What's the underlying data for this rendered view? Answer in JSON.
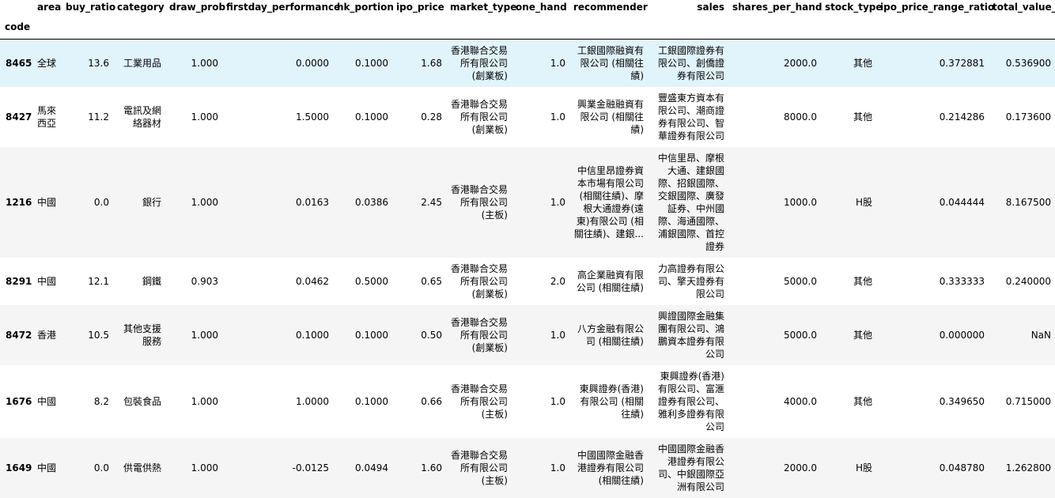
{
  "columns": [
    "area",
    "buy_ratio",
    "category",
    "draw_prob",
    "firstday_performance",
    "hk_portion",
    "ipo_price",
    "market_type",
    "one_hand",
    "recommender",
    "sales",
    "shares_per_hand",
    "stock_type",
    "ipo_price_range_ratio",
    "total_value_mid"
  ],
  "index_name": "code",
  "rows": [
    {
      "code": "8465",
      "area": "全球",
      "buy_ratio": "13.6",
      "category": "工業用品",
      "draw_prob": "1.000",
      "firstday_performance": "0.0000",
      "hk_portion": "0.1000",
      "ipo_price": "1.68",
      "market_type": "香港聯合交易所有限公司 (創業板)",
      "one_hand": "1.0",
      "recommender": "工銀國際融資有限公司 (相關往績)",
      "sales": "工銀國際證券有限公司、創僑證券有限公司",
      "shares_per_hand": "2000.0",
      "stock_type": "其他",
      "ipo_price_range_ratio": "0.372881",
      "total_value_mid": "0.536900"
    },
    {
      "code": "8427",
      "area": "馬來西亞",
      "buy_ratio": "11.2",
      "category": "電訊及網絡器材",
      "draw_prob": "1.000",
      "firstday_performance": "1.5000",
      "hk_portion": "0.1000",
      "ipo_price": "0.28",
      "market_type": "香港聯合交易所有限公司 (創業板)",
      "one_hand": "1.0",
      "recommender": "興業金融融資有限公司 (相關往績)",
      "sales": "豐盛東方資本有限公司、潮商證券有限公司、智華證券有限公司",
      "shares_per_hand": "8000.0",
      "stock_type": "其他",
      "ipo_price_range_ratio": "0.214286",
      "total_value_mid": "0.173600"
    },
    {
      "code": "1216",
      "area": "中國",
      "buy_ratio": "0.0",
      "category": "銀行",
      "draw_prob": "1.000",
      "firstday_performance": "0.0163",
      "hk_portion": "0.0386",
      "ipo_price": "2.45",
      "market_type": "香港聯合交易所有限公司 (主板)",
      "one_hand": "1.0",
      "recommender": "中信里昂證券資本市場有限公司 (相關往績)、摩根大通證券(遠東)有限公司 (相關往績)、建銀...",
      "sales": "中信里昂、摩根大通、建銀國際、招銀國際、交銀國際、廣發証券、中州國際、海通國際、浦銀國際、首控證券",
      "shares_per_hand": "1000.0",
      "stock_type": "H股",
      "ipo_price_range_ratio": "0.044444",
      "total_value_mid": "8.167500"
    },
    {
      "code": "8291",
      "area": "中國",
      "buy_ratio": "12.1",
      "category": "鋼鐵",
      "draw_prob": "0.903",
      "firstday_performance": "0.0462",
      "hk_portion": "0.5000",
      "ipo_price": "0.65",
      "market_type": "香港聯合交易所有限公司 (創業板)",
      "one_hand": "2.0",
      "recommender": "高企業融資有限公司 (相關往績)",
      "sales": "力高證券有限公司、擎天證券有限公司",
      "shares_per_hand": "5000.0",
      "stock_type": "其他",
      "ipo_price_range_ratio": "0.333333",
      "total_value_mid": "0.240000"
    },
    {
      "code": "8472",
      "area": "香港",
      "buy_ratio": "10.5",
      "category": "其他支援服務",
      "draw_prob": "1.000",
      "firstday_performance": "0.1000",
      "hk_portion": "0.1000",
      "ipo_price": "0.50",
      "market_type": "香港聯合交易所有限公司 (創業板)",
      "one_hand": "1.0",
      "recommender": "八方金融有限公司 (相關往績)",
      "sales": "興證國際金融集團有限公司、鴻鵬資本證券有限公司",
      "shares_per_hand": "5000.0",
      "stock_type": "其他",
      "ipo_price_range_ratio": "0.000000",
      "total_value_mid": "NaN"
    },
    {
      "code": "1676",
      "area": "中國",
      "buy_ratio": "8.2",
      "category": "包裝食品",
      "draw_prob": "1.000",
      "firstday_performance": "1.0000",
      "hk_portion": "0.1000",
      "ipo_price": "0.66",
      "market_type": "香港聯合交易所有限公司 (主板)",
      "one_hand": "1.0",
      "recommender": "東興證券(香港)有限公司 (相關往績)",
      "sales": "東興證券(香港)有限公司、富滙證券有限公司、雅利多證券有限公司",
      "shares_per_hand": "4000.0",
      "stock_type": "其他",
      "ipo_price_range_ratio": "0.349650",
      "total_value_mid": "0.715000"
    },
    {
      "code": "1649",
      "area": "中國",
      "buy_ratio": "0.0",
      "category": "供電供熱",
      "draw_prob": "1.000",
      "firstday_performance": "-0.0125",
      "hk_portion": "0.0494",
      "ipo_price": "1.60",
      "market_type": "香港聯合交易所有限公司 (主板)",
      "one_hand": "1.0",
      "recommender": "中國國際金融香港證券有限公司 (相關往績)",
      "sales": "中國國際金融香港證券有限公司、中銀國際亞洲有限公司",
      "shares_per_hand": "2000.0",
      "stock_type": "H股",
      "ipo_price_range_ratio": "0.048780",
      "total_value_mid": "1.262800"
    }
  ]
}
